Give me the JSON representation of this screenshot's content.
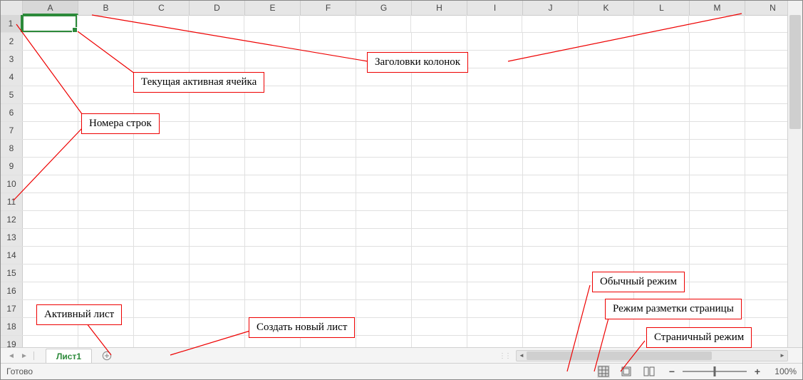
{
  "columns": [
    "A",
    "B",
    "C",
    "D",
    "E",
    "F",
    "G",
    "H",
    "I",
    "J",
    "K",
    "L",
    "M",
    "N"
  ],
  "row_count": 19,
  "active_column_index": 0,
  "active_row": 1,
  "sheet_tab": "Лист1",
  "status_text": "Готово",
  "zoom_text": "100%",
  "callouts": {
    "col_headers": "Заголовки колонок",
    "active_cell": "Текущая активная ячейка",
    "row_numbers": "Номера строк",
    "active_sheet": "Активный лист",
    "new_sheet": "Создать новый лист",
    "normal_view": "Обычный режим",
    "page_layout": "Режим разметки страницы",
    "page_break": "Страничный режим"
  }
}
